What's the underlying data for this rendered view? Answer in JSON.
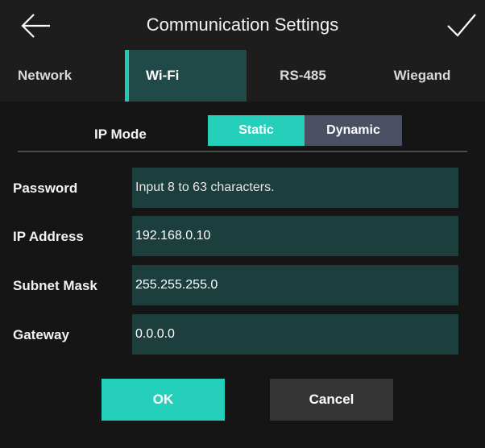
{
  "header": {
    "title": "Communication Settings",
    "back_icon": "arrow-left-icon",
    "confirm_icon": "checkmark-icon"
  },
  "tabs": [
    {
      "label": "Network",
      "active": false
    },
    {
      "label": "Wi-Fi",
      "active": true
    },
    {
      "label": "RS-485",
      "active": false
    },
    {
      "label": "Wiegand",
      "active": false
    }
  ],
  "ip_mode": {
    "label": "IP Mode",
    "options": [
      "Static",
      "Dynamic"
    ],
    "selected": "Static"
  },
  "fields": [
    {
      "label": "Password",
      "value": "",
      "placeholder": "Input 8 to 63 characters."
    },
    {
      "label": "IP Address",
      "value": "192.168.0.10"
    },
    {
      "label": "Subnet Mask",
      "value": "255.255.255.0"
    },
    {
      "label": "Gateway",
      "value": "0.0.0.0"
    }
  ],
  "actions": {
    "ok_label": "OK",
    "cancel_label": "Cancel"
  },
  "colors": {
    "accent": "#25cfba",
    "active_tab_bg": "#1f4a48",
    "input_bg": "#1c3f3d",
    "inactive_segment": "#4a4f63",
    "background": "#151515"
  }
}
